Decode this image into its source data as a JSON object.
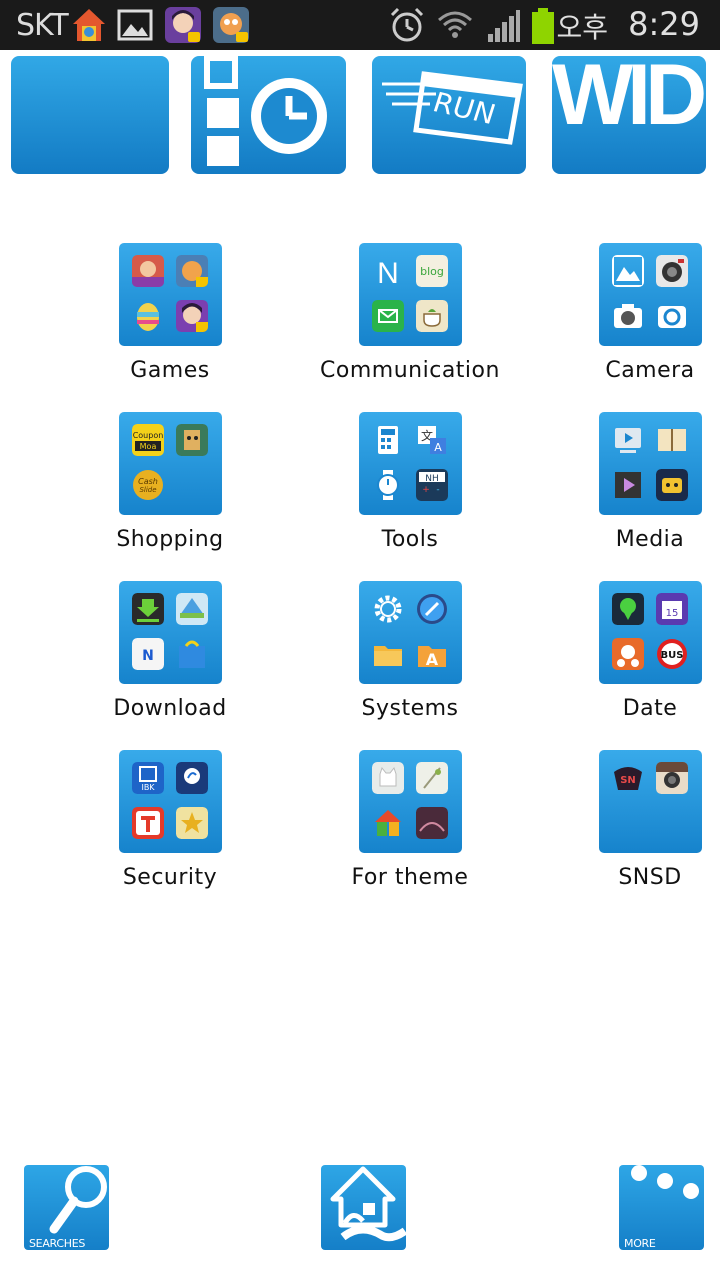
{
  "status_bar": {
    "carrier": "SKT",
    "ampm": "오후",
    "time": "8:29",
    "icons": [
      "home-launcher-icon",
      "gallery-icon",
      "game-avatar-icon",
      "game-hero-icon",
      "alarm-icon",
      "wifi-icon",
      "signal-icon",
      "battery-icon"
    ]
  },
  "widgets": [
    {
      "name": "blank-widget"
    },
    {
      "name": "task-timer-widget"
    },
    {
      "name": "run-widget",
      "text": "RUN"
    },
    {
      "name": "wid-widget",
      "text": "WID"
    }
  ],
  "folders": [
    {
      "label": "Games",
      "icons": [
        "games-app-1-icon",
        "games-app-2-icon",
        "egg-icon",
        "girl-avatar-icon"
      ]
    },
    {
      "label": "Communication",
      "icons": [
        "naver-icon",
        "blog-icon",
        "message-icon",
        "cafe-icon"
      ]
    },
    {
      "label": "Camera",
      "icons": [
        "picture-icon",
        "camera-lens-icon",
        "camera-icon",
        "camera-white-icon"
      ]
    },
    {
      "label": "Shopping",
      "icons": [
        "coupon-moa-icon",
        "shopping-character-icon",
        "cash-slide-icon",
        ""
      ]
    },
    {
      "label": "Tools",
      "icons": [
        "calculator-icon",
        "translate-icon",
        "alarm-watch-icon",
        "nh-calculator-icon"
      ]
    },
    {
      "label": "Media",
      "icons": [
        "video-icon",
        "book-icon",
        "movie-icon",
        "tv-icon"
      ]
    },
    {
      "label": "Download",
      "icons": [
        "download-icon",
        "store-icon",
        "naver-n-icon",
        "market-icon"
      ]
    },
    {
      "label": "Systems",
      "icons": [
        "settings-gear-icon",
        "cleaner-icon",
        "folder-icon",
        "app-a-icon"
      ]
    },
    {
      "label": "Date",
      "icons": [
        "map-pin-icon",
        "calendar-icon",
        "delivery-icon",
        "bus-icon"
      ]
    },
    {
      "label": "Security",
      "icons": [
        "ibk-icon",
        "shinhan-icon",
        "t-icon",
        "star-card-icon"
      ]
    },
    {
      "label": "For theme",
      "icons": [
        "cat-icon",
        "theme-icon",
        "home-blocks-icon",
        "dark-theme-icon"
      ]
    },
    {
      "label": "SNSD",
      "icons": [
        "snsd-logo-icon",
        "instagram-icon",
        "",
        ""
      ]
    }
  ],
  "dock": [
    {
      "label": "SEARCHES",
      "icon": "search-icon"
    },
    {
      "label": "",
      "icon": "home-icon"
    },
    {
      "label": "MORE",
      "icon": "more-dots-icon"
    }
  ],
  "colors": {
    "tile_blue": "#1f8fd8",
    "status_bg": "#1a1a1a",
    "battery_green": "#8fd400"
  }
}
